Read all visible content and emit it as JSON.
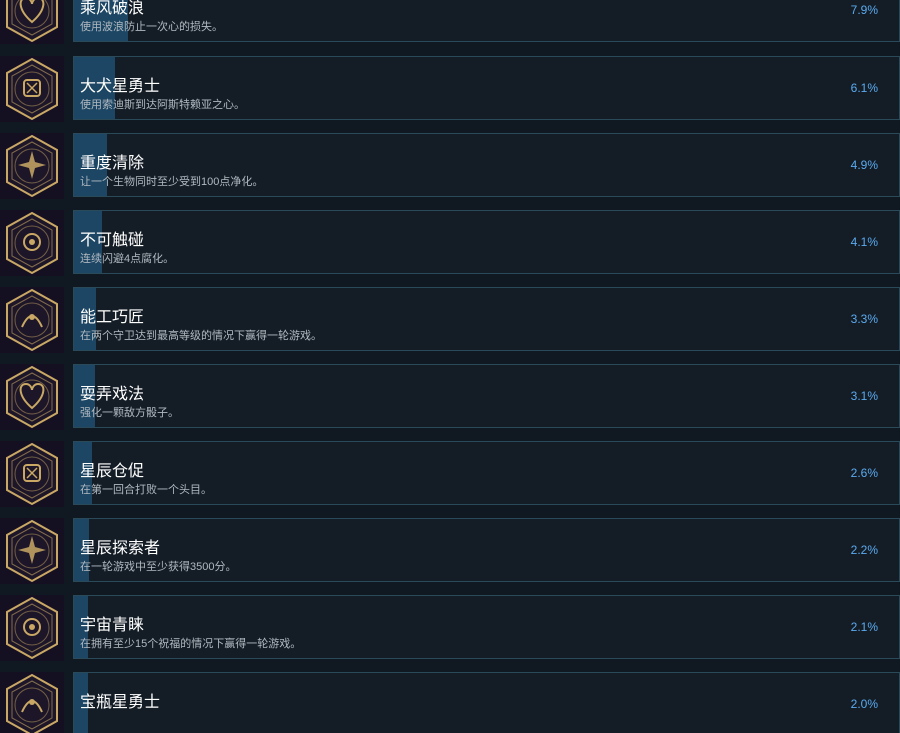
{
  "achievements": [
    {
      "title": "乘风破浪",
      "desc": "使用波浪防止一次心的损失。",
      "percent": "7.9%",
      "pct_value": 7.9,
      "icon": "heart-wave-emblem-icon"
    },
    {
      "title": "大犬星勇士",
      "desc": "使用索迪斯到达阿斯特赖亚之心。",
      "percent": "6.1%",
      "pct_value": 6.1,
      "icon": "canis-major-emblem-icon"
    },
    {
      "title": "重度清除",
      "desc": "让一个生物同时至少受到100点净化。",
      "percent": "4.9%",
      "pct_value": 4.9,
      "icon": "burst-star-emblem-icon"
    },
    {
      "title": "不可触碰",
      "desc": "连续闪避4点腐化。",
      "percent": "4.1%",
      "pct_value": 4.1,
      "icon": "dragon-emblem-icon"
    },
    {
      "title": "能工巧匠",
      "desc": "在两个守卫达到最高等级的情况下赢得一轮游戏。",
      "percent": "3.3%",
      "pct_value": 3.3,
      "icon": "twin-guardians-emblem-icon"
    },
    {
      "title": "耍弄戏法",
      "desc": "强化一颗敌方骰子。",
      "percent": "3.1%",
      "pct_value": 3.1,
      "icon": "trickster-emblem-icon"
    },
    {
      "title": "星辰仓促",
      "desc": "在第一回合打败一个头目。",
      "percent": "2.6%",
      "pct_value": 2.6,
      "icon": "four-point-star-emblem-icon"
    },
    {
      "title": "星辰探索者",
      "desc": "在一轮游戏中至少获得3500分。",
      "percent": "2.2%",
      "pct_value": 2.2,
      "icon": "starfield-explorer-emblem-icon"
    },
    {
      "title": "宇宙青睐",
      "desc": "在拥有至少15个祝福的情况下赢得一轮游戏。",
      "percent": "2.1%",
      "pct_value": 2.1,
      "icon": "cosmic-eye-emblem-icon"
    },
    {
      "title": "宝瓶星勇士",
      "desc": "",
      "percent": "2.0%",
      "pct_value": 2.0,
      "icon": "aquarius-emblem-icon"
    }
  ],
  "colors": {
    "icon_gold": "#c9a865",
    "icon_bg": "#150f22",
    "bar": "#1c4663",
    "percent_text": "#5aaaf0"
  }
}
